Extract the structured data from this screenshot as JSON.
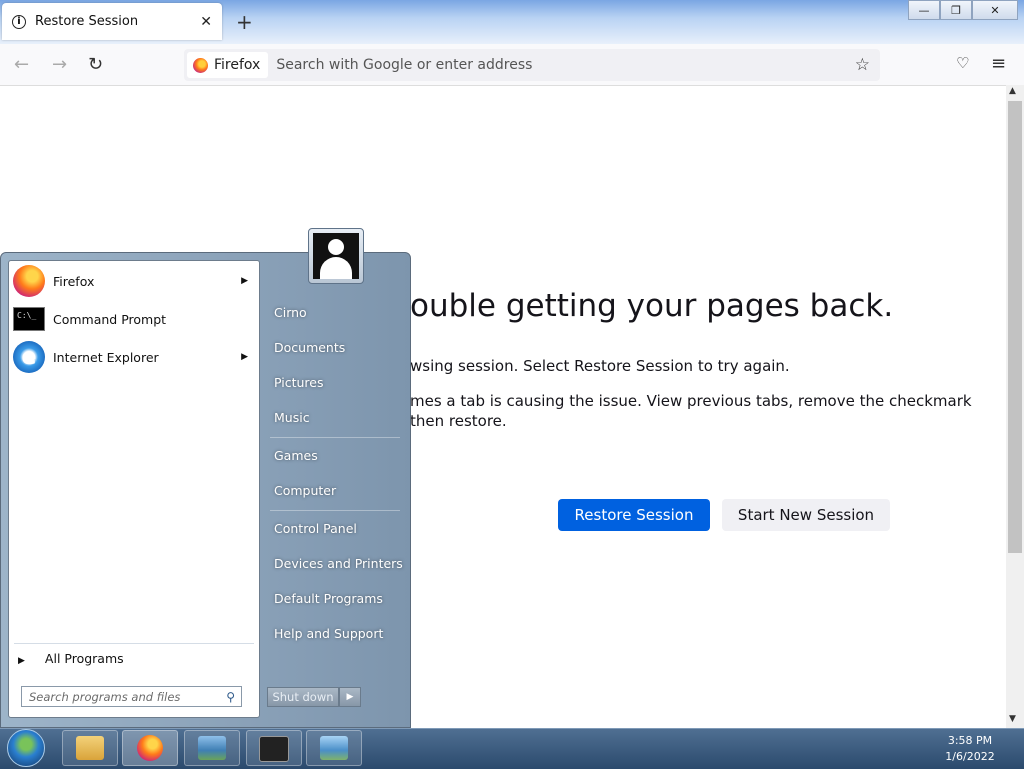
{
  "browser": {
    "tab": {
      "title": "Restore Session",
      "close": "✕"
    },
    "newtab": "+",
    "window": {
      "minimize": "—",
      "restore": "❐",
      "close": "✕"
    },
    "nav": {
      "back": "←",
      "forward": "→",
      "reload": "↻"
    },
    "identity": "Firefox",
    "url_placeholder": "Search with Google or enter address",
    "bookmark_icon": "star-icon",
    "pocket": "♡",
    "menu": "≡"
  },
  "page": {
    "heading": "ouble getting your pages back.",
    "line1": "wsing session. Select Restore Session to try again.",
    "line2": "mes a tab is causing the issue. View previous tabs, remove the checkmark",
    "line3": "then restore.",
    "buttons": {
      "restore": "Restore Session",
      "new_session": "Start New Session"
    }
  },
  "startmenu": {
    "programs": [
      {
        "label": "Firefox",
        "has_submenu": true
      },
      {
        "label": "Command Prompt",
        "has_submenu": false
      },
      {
        "label": "Internet Explorer",
        "has_submenu": true
      }
    ],
    "all_programs": "All Programs",
    "search_placeholder": "Search programs and files",
    "right_items": [
      "Cirno",
      "Documents",
      "Pictures",
      "Music",
      "Games",
      "Computer",
      "Control Panel",
      "Devices and Printers",
      "Default Programs",
      "Help and Support"
    ],
    "shutdown": "Shut down",
    "cmd_glyph": "C:\\_"
  },
  "taskbar": {
    "time": "3:58 PM",
    "date": "1/6/2022"
  },
  "colors": {
    "accent": "#0061e0",
    "taskbar": "#2b4a6d"
  }
}
